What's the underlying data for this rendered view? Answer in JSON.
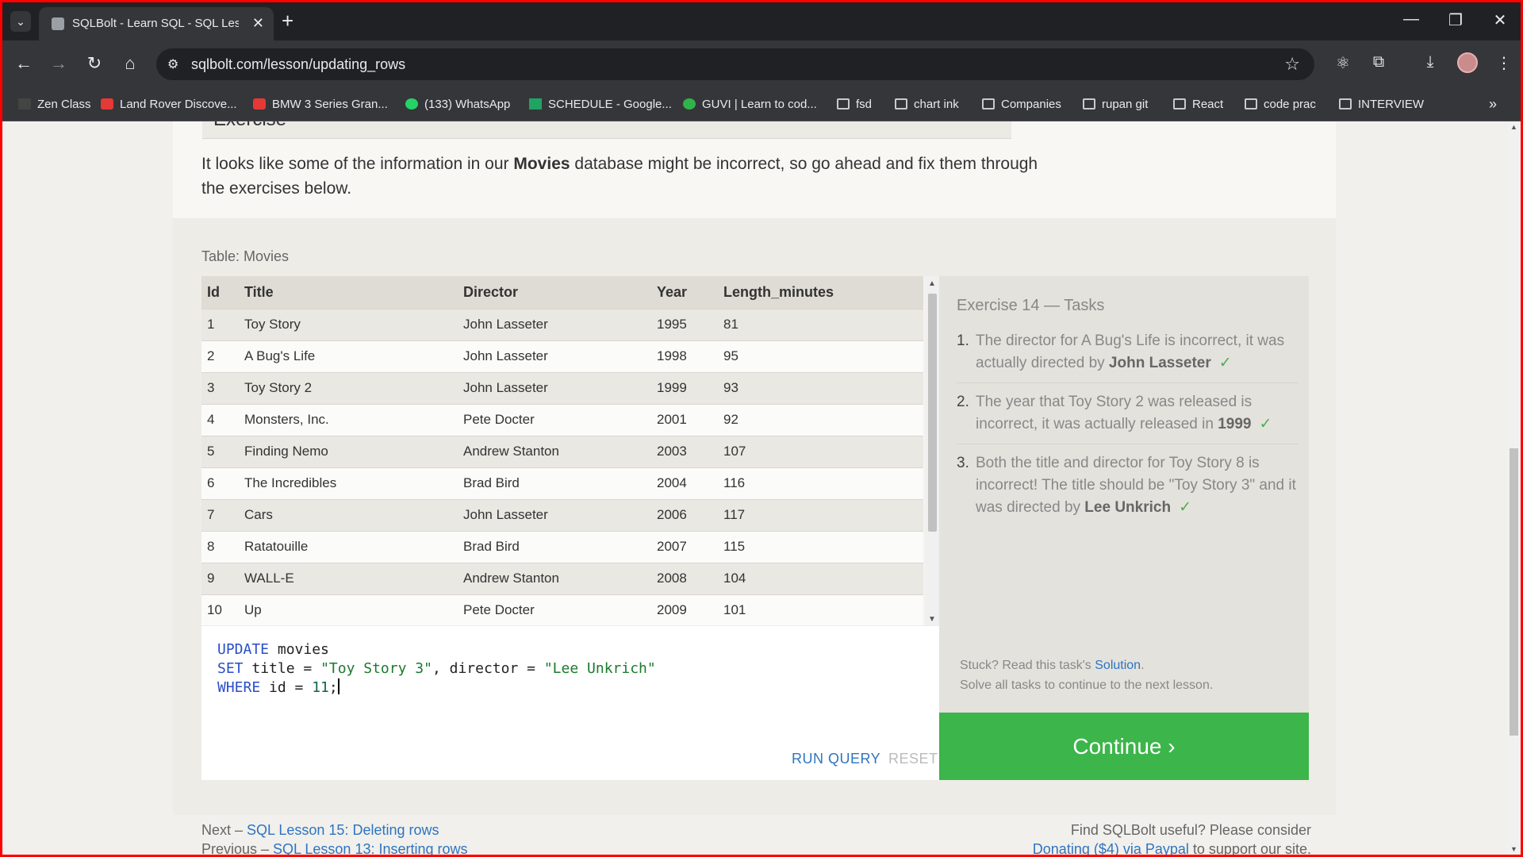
{
  "browser": {
    "tab_title": "SQLBolt - Learn SQL - SQL Less",
    "url": "sqlbolt.com/lesson/updating_rows",
    "bookmarks": [
      "Zen Class",
      "Land Rover Discove...",
      "BMW 3 Series Gran...",
      "(133) WhatsApp",
      "SCHEDULE - Google...",
      "GUVI | Learn to cod...",
      "fsd",
      "chart ink",
      "Companies",
      "rupan git",
      "React",
      "code prac",
      "INTERVIEW"
    ]
  },
  "exercise": {
    "heading": "Exercise",
    "intro_before": "It looks like some of the information in our ",
    "intro_bold": "Movies",
    "intro_after": " database might be incorrect, so go ahead and fix them through the exercises below.",
    "table_label": "Table: Movies"
  },
  "table": {
    "columns": [
      "Id",
      "Title",
      "Director",
      "Year",
      "Length_minutes"
    ],
    "rows": [
      [
        "1",
        "Toy Story",
        "John Lasseter",
        "1995",
        "81"
      ],
      [
        "2",
        "A Bug's Life",
        "John Lasseter",
        "1998",
        "95"
      ],
      [
        "3",
        "Toy Story 2",
        "John Lasseter",
        "1999",
        "93"
      ],
      [
        "4",
        "Monsters, Inc.",
        "Pete Docter",
        "2001",
        "92"
      ],
      [
        "5",
        "Finding Nemo",
        "Andrew Stanton",
        "2003",
        "107"
      ],
      [
        "6",
        "The Incredibles",
        "Brad Bird",
        "2004",
        "116"
      ],
      [
        "7",
        "Cars",
        "John Lasseter",
        "2006",
        "117"
      ],
      [
        "8",
        "Ratatouille",
        "Brad Bird",
        "2007",
        "115"
      ],
      [
        "9",
        "WALL-E",
        "Andrew Stanton",
        "2008",
        "104"
      ],
      [
        "10",
        "Up",
        "Pete Docter",
        "2009",
        "101"
      ]
    ]
  },
  "editor": {
    "line1_kw": "UPDATE",
    "line1_rest": " movies",
    "line2_kw": "SET",
    "line2_a": " title = ",
    "line2_str1": "\"Toy Story 3\"",
    "line2_b": ", director = ",
    "line2_str2": "\"Lee Unkrich\"",
    "line3_kw": "WHERE",
    "line3_a": " id = ",
    "line3_num": "11",
    "line3_end": ";",
    "run_label": "RUN QUERY",
    "reset_label": "RESET"
  },
  "tasks": {
    "title": "Exercise 14 — Tasks",
    "items": [
      {
        "num": "1.",
        "text": "The director for A Bug's Life is incorrect, it was actually directed by ",
        "bold": "John Lasseter",
        "check": "✓"
      },
      {
        "num": "2.",
        "text": "The year that Toy Story 2 was released is incorrect, it was actually released in ",
        "bold": "1999",
        "check": "✓"
      },
      {
        "num": "3.",
        "text": "Both the title and director for Toy Story 8 is incorrect! The title should be \"Toy Story 3\" and it was directed by ",
        "bold": "Lee Unkrich",
        "check": "✓"
      }
    ],
    "stuck_text": "Stuck? Read this task's ",
    "solution_link": "Solution",
    "stuck_end": ".",
    "solve_all": "Solve all tasks to continue to the next lesson.",
    "continue_label": "Continue ›"
  },
  "footer": {
    "next_prefix": "Next – ",
    "next_link": "SQL Lesson 15: Deleting rows",
    "prev_prefix": "Previous – ",
    "prev_link": "SQL Lesson 13: Inserting rows",
    "useful": "Find SQLBolt useful? Please consider",
    "donate_link": "Donating ($4) via Paypal",
    "donate_rest": " to support our site."
  },
  "colors": {
    "accent_green": "#3cb54a",
    "link_blue": "#2e74c0",
    "keyword_blue": "#2a4ec8",
    "string_green": "#1a7a2e"
  }
}
